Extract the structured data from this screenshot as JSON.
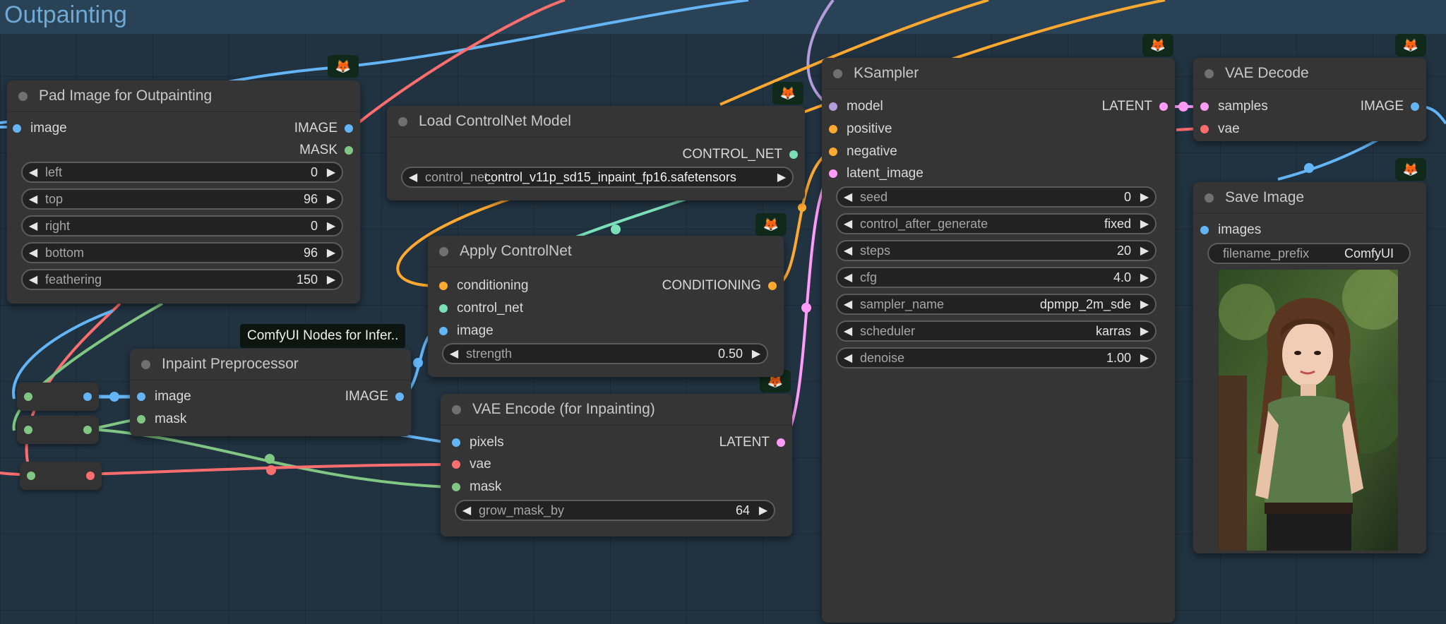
{
  "group": {
    "title": "Outpainting"
  },
  "badge_icon": "🦊",
  "tooltip": "ComfyUI Nodes for Infer..",
  "colors": {
    "image": "#64b5f6",
    "mask": "#81c784",
    "latent": "#ff9cf9",
    "vae": "#ff6e6e",
    "conditioning": "#ffa931",
    "control_net": "#7be0b8",
    "model": "#b39ddb"
  },
  "pad_node": {
    "title": "Pad Image for Outpainting",
    "input": "image",
    "outputs": [
      "IMAGE",
      "MASK"
    ],
    "widgets": [
      {
        "name": "left",
        "value": "0"
      },
      {
        "name": "top",
        "value": "96"
      },
      {
        "name": "right",
        "value": "0"
      },
      {
        "name": "bottom",
        "value": "96"
      },
      {
        "name": "feathering",
        "value": "150"
      }
    ]
  },
  "loadcn_node": {
    "title": "Load ControlNet Model",
    "output": "CONTROL_NET",
    "widget_name": "control_net_name",
    "widget_value": "control_v11p_sd15_inpaint_fp16.safetensors"
  },
  "applycn_node": {
    "title": "Apply ControlNet",
    "inputs": [
      "conditioning",
      "control_net",
      "image"
    ],
    "output": "CONDITIONING",
    "widget": {
      "name": "strength",
      "value": "0.50"
    }
  },
  "inpaintpre_node": {
    "title": "Inpaint Preprocessor",
    "inputs": [
      "image",
      "mask"
    ],
    "output": "IMAGE"
  },
  "vaeenc_node": {
    "title": "VAE Encode (for Inpainting)",
    "inputs": [
      "pixels",
      "vae",
      "mask"
    ],
    "output": "LATENT",
    "widget": {
      "name": "grow_mask_by",
      "value": "64"
    }
  },
  "ksampler_node": {
    "title": "KSampler",
    "inputs": [
      "model",
      "positive",
      "negative",
      "latent_image"
    ],
    "output": "LATENT",
    "widgets": [
      {
        "name": "seed",
        "value": "0"
      },
      {
        "name": "control_after_generate",
        "value": "fixed"
      },
      {
        "name": "steps",
        "value": "20"
      },
      {
        "name": "cfg",
        "value": "4.0"
      },
      {
        "name": "sampler_name",
        "value": "dpmpp_2m_sde"
      },
      {
        "name": "scheduler",
        "value": "karras"
      },
      {
        "name": "denoise",
        "value": "1.00"
      }
    ]
  },
  "vaedec_node": {
    "title": "VAE Decode",
    "inputs": [
      "samples",
      "vae"
    ],
    "output": "IMAGE"
  },
  "save_node": {
    "title": "Save Image",
    "input": "images",
    "widget": {
      "name": "filename_prefix",
      "value": "ComfyUI"
    }
  }
}
